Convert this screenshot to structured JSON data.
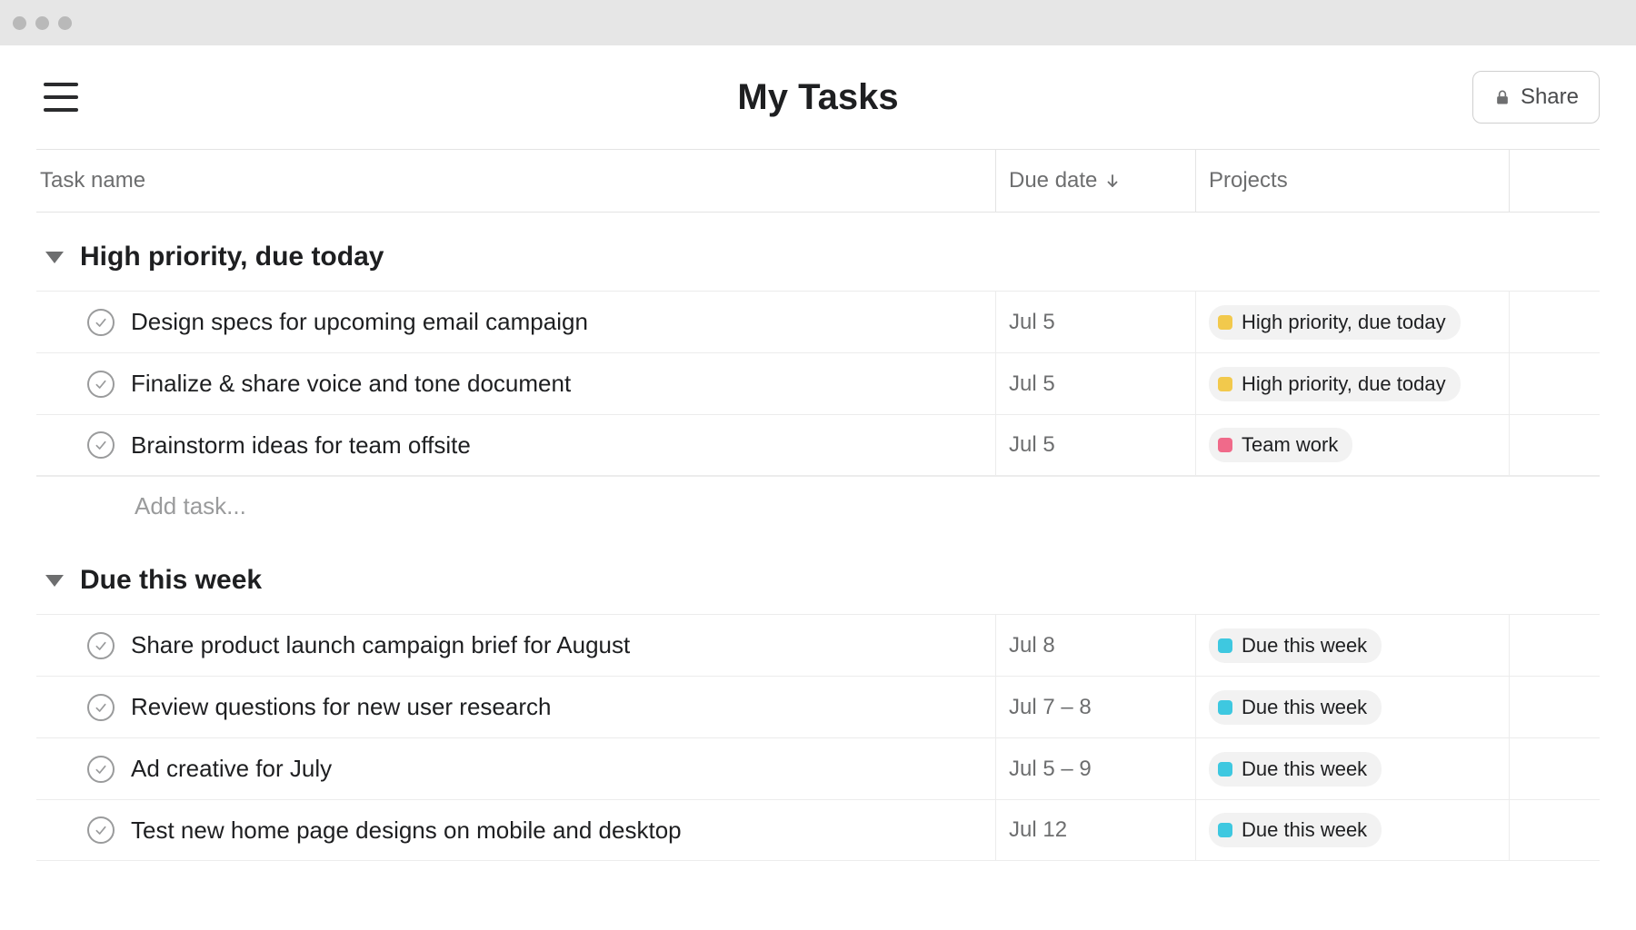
{
  "header": {
    "title": "My Tasks",
    "share_label": "Share"
  },
  "columns": {
    "task_name": "Task name",
    "due_date": "Due date",
    "projects": "Projects"
  },
  "add_task_placeholder": "Add task...",
  "project_colors": {
    "high_priority": "#f2c94c",
    "team_work": "#f06a8a",
    "due_this_week": "#3ec8e0"
  },
  "sections": [
    {
      "title": "High priority, due today",
      "has_add": true,
      "tasks": [
        {
          "name": "Design specs for upcoming email campaign",
          "due": "Jul 5",
          "project_label": "High priority, due today",
          "project_color_key": "high_priority"
        },
        {
          "name": "Finalize & share voice and tone document",
          "due": "Jul 5",
          "project_label": "High priority, due today",
          "project_color_key": "high_priority"
        },
        {
          "name": "Brainstorm ideas for team offsite",
          "due": "Jul 5",
          "project_label": "Team work",
          "project_color_key": "team_work"
        }
      ]
    },
    {
      "title": "Due this week",
      "has_add": false,
      "tasks": [
        {
          "name": "Share product launch campaign brief for August",
          "due": "Jul 8",
          "project_label": "Due this week",
          "project_color_key": "due_this_week"
        },
        {
          "name": "Review questions for new user research",
          "due": "Jul 7 – 8",
          "project_label": "Due this week",
          "project_color_key": "due_this_week"
        },
        {
          "name": "Ad creative for July",
          "due": "Jul 5 – 9",
          "project_label": "Due this week",
          "project_color_key": "due_this_week"
        },
        {
          "name": "Test new home page designs on mobile and desktop",
          "due": "Jul 12",
          "project_label": "Due this week",
          "project_color_key": "due_this_week"
        }
      ]
    }
  ]
}
